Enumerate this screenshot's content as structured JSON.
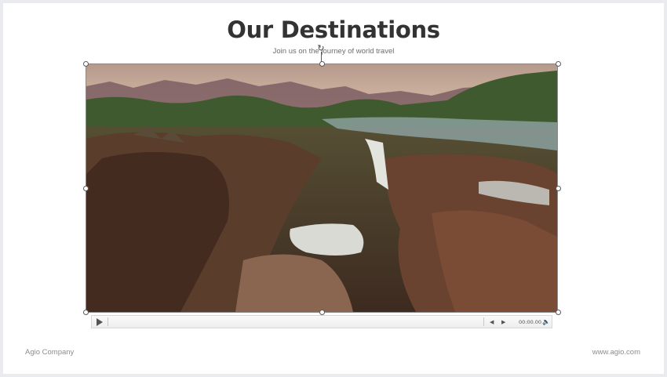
{
  "slide": {
    "title": "Our Destinations",
    "subtitle": "Join us on the journey of world travel",
    "footer_left": "Agio Company",
    "footer_right": "www.agio.com"
  },
  "video": {
    "time": "00:00.00",
    "play_icon": "play-icon",
    "back_icon": "skip-back-icon",
    "forward_icon": "skip-forward-icon",
    "volume_icon": "volume-icon"
  },
  "colors": {
    "title": "#333333",
    "text_muted": "#8d8d8d",
    "background": "#ffffff"
  }
}
